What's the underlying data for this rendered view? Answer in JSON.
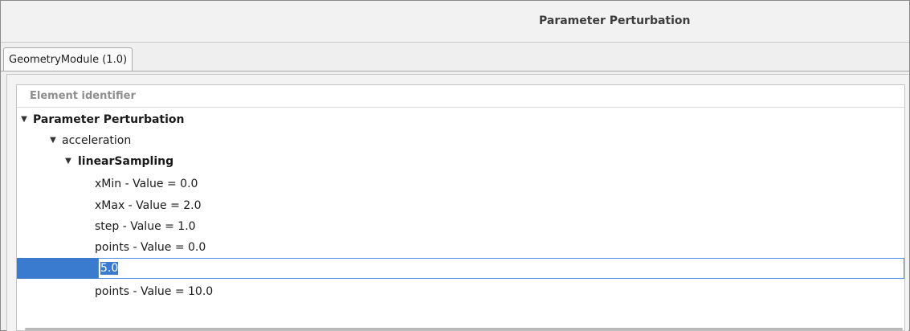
{
  "window": {
    "title": "Parameter Perturbation"
  },
  "tabs": [
    {
      "label": "GeometryModule (1.0)"
    }
  ],
  "tree": {
    "header": "Element identifier",
    "rows": [
      {
        "label": "Parameter Perturbation",
        "expanded": true
      },
      {
        "label": "acceleration",
        "expanded": true
      },
      {
        "label": "linearSampling",
        "expanded": true
      },
      {
        "label": "xMin - Value = 0.0"
      },
      {
        "label": "xMax - Value = 2.0"
      },
      {
        "label": "step - Value = 1.0"
      },
      {
        "label": "points - Value = 0.0"
      },
      {
        "label": "points - Value = 10.0"
      }
    ],
    "editor": {
      "value": "5.0"
    }
  },
  "icons": {
    "expanded": "triangle-down-icon"
  },
  "colors": {
    "selection": "#3a7bd0",
    "editor_border": "#4a90e2"
  }
}
